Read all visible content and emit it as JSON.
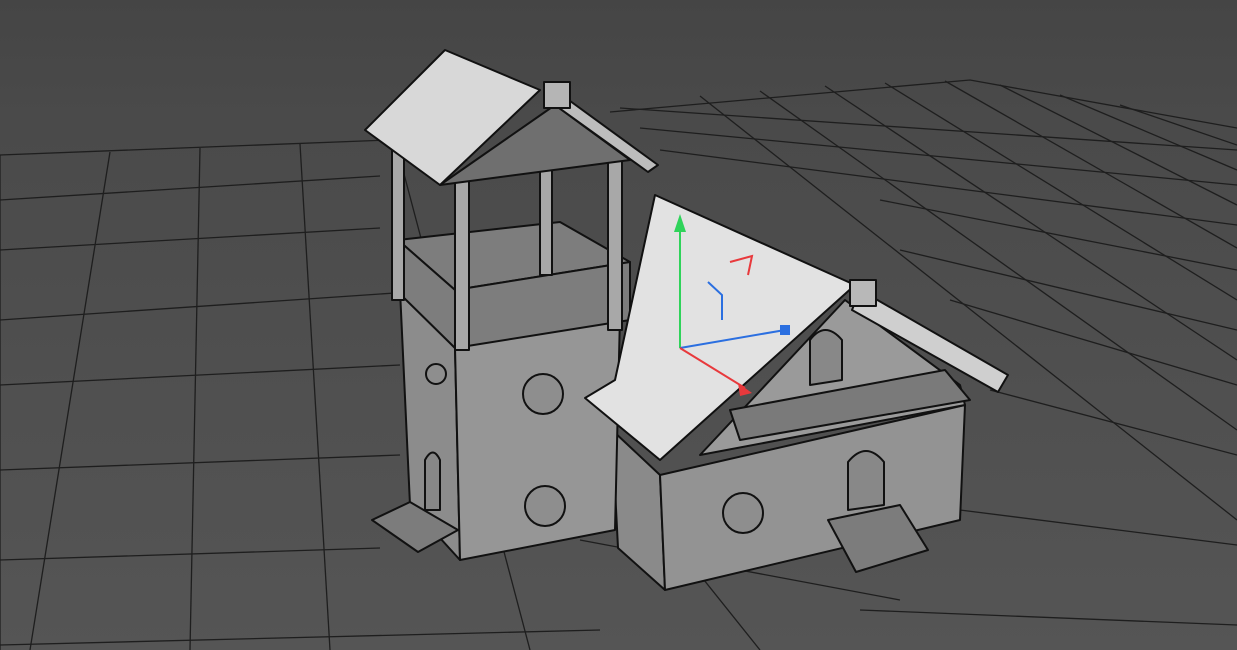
{
  "viewport": {
    "type": "3d-perspective-viewport",
    "shading": "flat-gray-with-wireframe-edges",
    "background_color": "#4b4b4b",
    "grid_line_color": "#1e1e1e"
  },
  "model": {
    "description_icon": "house-with-tower-model",
    "wall_color": "#8f8f8f",
    "roof_color": "#d9d9d9",
    "edge_color": "#111111"
  },
  "gizmo": {
    "icon": "move-rotate-gizmo",
    "x_color": "#e8393c",
    "y_color": "#2fd35a",
    "z_color": "#2b6fe0"
  }
}
